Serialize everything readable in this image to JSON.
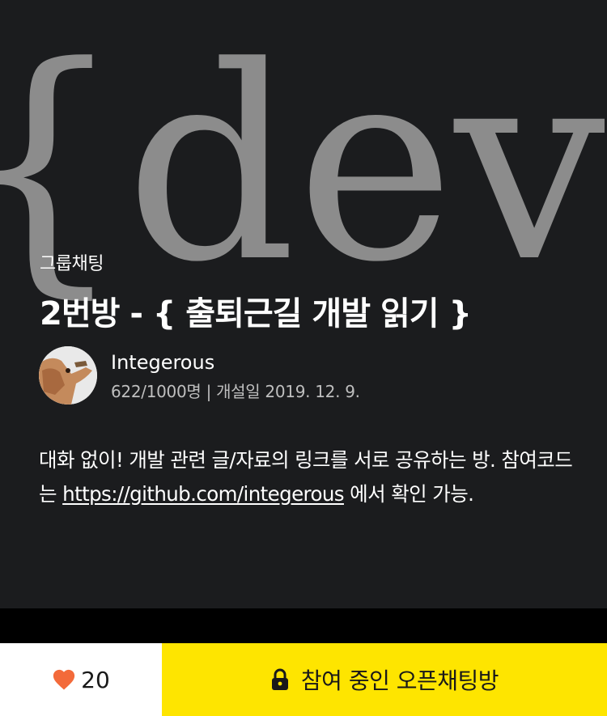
{
  "cover": {
    "art_text": "{dev}"
  },
  "room": {
    "category": "그룹채팅",
    "title": "2번방 - { 출퇴근길 개발 읽기 }",
    "owner": "Integerous",
    "meta": "622/1000명 | 개설일 2019. 12. 9.",
    "description_part1": "대화 없이! 개발 관련 글/자료의 링크를 서로 공유하는 방. 참여코드는 ",
    "description_link": "https://github.com/integerous",
    "description_part2": " 에서 확인 가능."
  },
  "footer": {
    "like_count": "20",
    "join_label": "참여 중인 오픈채팅방"
  },
  "icons": {
    "like": "heart-icon",
    "join": "lock-icon"
  },
  "colors": {
    "heart": "#f36a3a",
    "join_button": "#fee500",
    "background": "#1b1c1e"
  }
}
